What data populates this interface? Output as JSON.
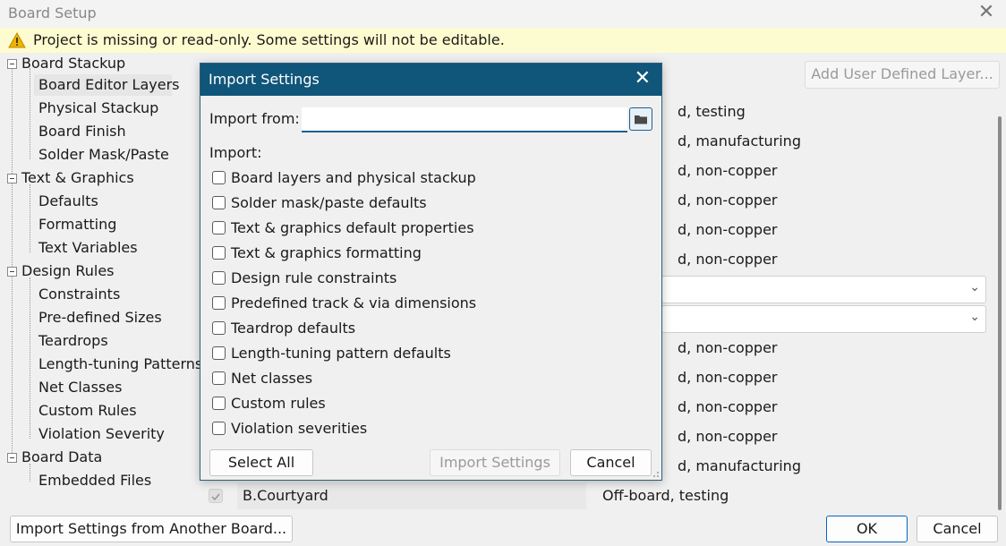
{
  "window": {
    "title": "Board Setup",
    "close_glyph": "✕"
  },
  "warning": {
    "icon": "warning-icon",
    "text": "Project is missing or read-only. Some settings will not be editable.",
    "icon_color": "#f0b400"
  },
  "tree": {
    "nodes": [
      {
        "label": "Board Stackup"
      },
      {
        "label": "Board Editor Layers"
      },
      {
        "label": "Physical Stackup"
      },
      {
        "label": "Board Finish"
      },
      {
        "label": "Solder Mask/Paste"
      },
      {
        "label": "Text & Graphics"
      },
      {
        "label": "Defaults"
      },
      {
        "label": "Formatting"
      },
      {
        "label": "Text Variables"
      },
      {
        "label": "Design Rules"
      },
      {
        "label": "Constraints"
      },
      {
        "label": "Pre-defined Sizes"
      },
      {
        "label": "Teardrops"
      },
      {
        "label": "Length-tuning Patterns"
      },
      {
        "label": "Net Classes"
      },
      {
        "label": "Custom Rules"
      },
      {
        "label": "Violation Severity"
      },
      {
        "label": "Board Data"
      },
      {
        "label": "Embedded Files"
      }
    ]
  },
  "panel": {
    "add_layer_label": "Add User Defined Layer...",
    "row_texts": [
      "d, testing",
      "d, manufacturing",
      "d, non-copper",
      "d, non-copper",
      "d, non-copper",
      "d, non-copper",
      "d, non-copper",
      "d, non-copper",
      "d, non-copper",
      "d, non-copper",
      "d, manufacturing"
    ],
    "last_row": {
      "layer": "B.Courtyard",
      "type": "Off-board, testing"
    }
  },
  "bottom": {
    "import_button": "Import Settings from Another Board...",
    "ok_button": "OK",
    "cancel_button": "Cancel"
  },
  "dialog": {
    "title": "Import Settings",
    "close_glyph": "✕",
    "import_from_label": "Import from:",
    "import_from_value": "",
    "browse_icon": "folder-icon",
    "import_label": "Import:",
    "options": [
      {
        "label": "Board layers and physical stackup",
        "checked": false
      },
      {
        "label": "Solder mask/paste defaults",
        "checked": false
      },
      {
        "label": "Text & graphics default properties",
        "checked": false
      },
      {
        "label": "Text & graphics formatting",
        "checked": false
      },
      {
        "label": "Design rule constraints",
        "checked": false
      },
      {
        "label": "Predefined track & via dimensions",
        "checked": false
      },
      {
        "label": "Teardrop defaults",
        "checked": false
      },
      {
        "label": "Length-tuning pattern defaults",
        "checked": false
      },
      {
        "label": "Net classes",
        "checked": false
      },
      {
        "label": "Custom rules",
        "checked": false
      },
      {
        "label": "Violation severities",
        "checked": false
      }
    ],
    "select_all_button": "Select All",
    "import_settings_button": "Import Settings",
    "cancel_button": "Cancel"
  },
  "colors": {
    "dialog_title_bg": "#10557a",
    "accent": "#0067c0",
    "warning_bg": "#fdfcd0"
  }
}
